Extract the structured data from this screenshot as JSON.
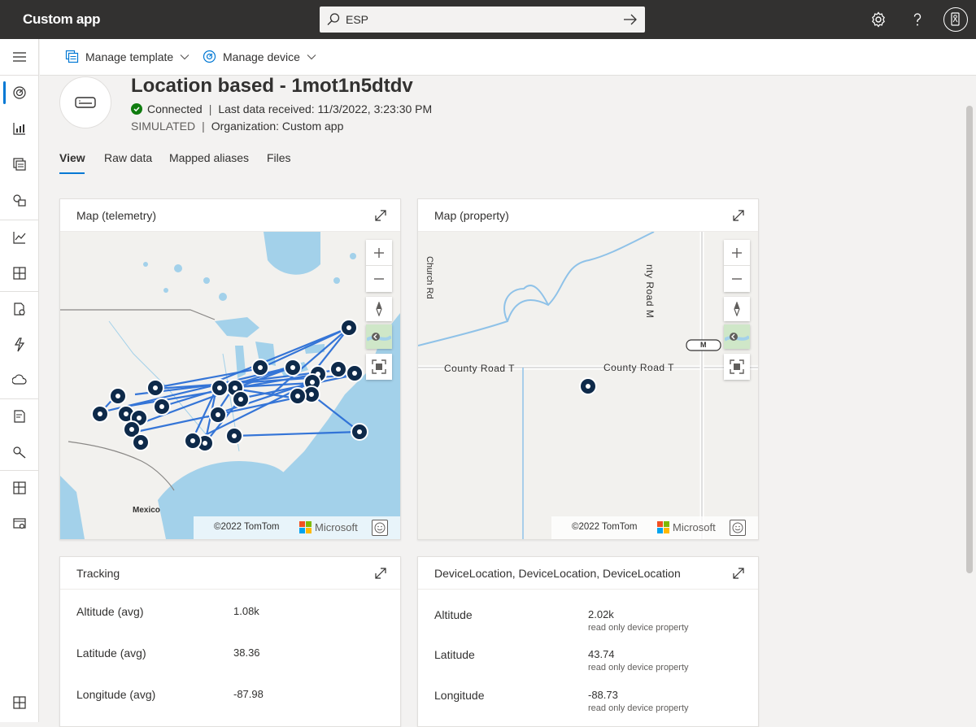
{
  "app": {
    "title": "Custom app"
  },
  "search": {
    "value": "ESP"
  },
  "commands": {
    "manage_template": "Manage template",
    "manage_device": "Manage device"
  },
  "device": {
    "title": "Location based - 1mot1n5dtdv",
    "status": "Connected",
    "last_data": "Last data received: 11/3/2022, 3:23:30 PM",
    "mode": "SIMULATED",
    "organization": "Organization: Custom app"
  },
  "tabs": [
    "View",
    "Raw data",
    "Mapped aliases",
    "Files"
  ],
  "cards": {
    "map_telemetry": {
      "title": "Map (telemetry)",
      "label_mexico": "Mexico",
      "copyright": "©2022 TomTom",
      "brand": "Microsoft"
    },
    "map_property": {
      "title": "Map (property)",
      "copyright": "©2022 TomTom",
      "brand": "Microsoft",
      "road_label_left": "County Road T",
      "road_label_right": "County Road T",
      "road_label_vertical": "nty Road M",
      "road_label_church": "Church Rd",
      "shield": "M"
    },
    "tracking": {
      "title": "Tracking",
      "rows": [
        {
          "label": "Altitude (avg)",
          "value": "1.08k"
        },
        {
          "label": "Latitude (avg)",
          "value": "38.36"
        },
        {
          "label": "Longitude (avg)",
          "value": "-87.98"
        }
      ]
    },
    "device_location": {
      "title": "DeviceLocation, DeviceLocation, DeviceLocation",
      "rows": [
        {
          "label": "Altitude",
          "value": "2.02k",
          "sub": "read only device property"
        },
        {
          "label": "Latitude",
          "value": "43.74",
          "sub": "read only device property"
        },
        {
          "label": "Longitude",
          "value": "-88.73",
          "sub": "read only device property"
        }
      ]
    }
  },
  "colors": {
    "topbar": "#323130",
    "accent": "#0078d4",
    "route": "#2b6fd6",
    "marker": "#0e2a4a",
    "water": "#a3d1ea",
    "land": "#f2f1ee",
    "status_green": "#107c10"
  }
}
